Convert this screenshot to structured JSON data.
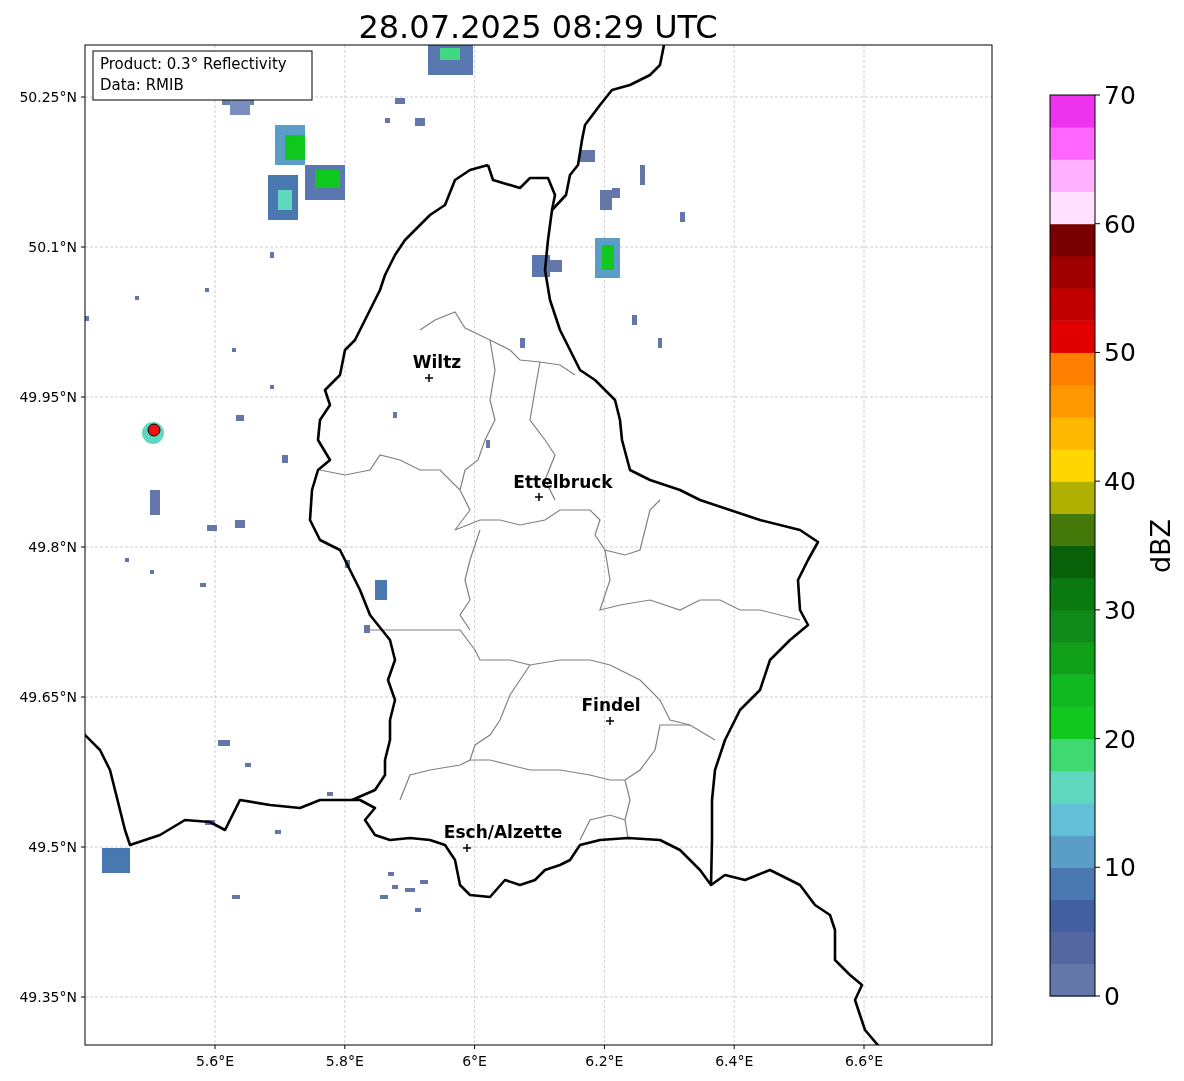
{
  "title": "28.07.2025 08:29 UTC",
  "info_box": {
    "lines": [
      "Product: 0.3° Reflectivity",
      "Data: RMIB"
    ]
  },
  "map": {
    "lat_ticks": [
      "50.25°N",
      "50.1°N",
      "49.95°N",
      "49.8°N",
      "49.65°N",
      "49.5°N",
      "49.35°N"
    ],
    "lon_ticks": [
      "5.6°E",
      "5.8°E",
      "6°E",
      "6.2°E",
      "6.4°E",
      "6.6°E"
    ],
    "places": [
      {
        "name": "Wiltz"
      },
      {
        "name": "Ettelbruck"
      },
      {
        "name": "Findel"
      },
      {
        "name": "Esch/Alzette"
      }
    ]
  },
  "colorbar": {
    "label": "dBZ",
    "ticks": [
      "70",
      "60",
      "50",
      "40",
      "30",
      "20",
      "10",
      "0"
    ],
    "bins": [
      {
        "color": "#6577a8"
      },
      {
        "color": "#5566a0"
      },
      {
        "color": "#4260a0"
      },
      {
        "color": "#4a78b0"
      },
      {
        "color": "#5a9ec8"
      },
      {
        "color": "#63c0d8"
      },
      {
        "color": "#60d8c0"
      },
      {
        "color": "#40d870"
      },
      {
        "color": "#10c820"
      },
      {
        "color": "#10b820"
      },
      {
        "color": "#10a018"
      },
      {
        "color": "#108a18"
      },
      {
        "color": "#0a7a10"
      },
      {
        "color": "#086008"
      },
      {
        "color": "#457a0a"
      },
      {
        "color": "#b0b000"
      },
      {
        "color": "#ffd700"
      },
      {
        "color": "#ffb800"
      },
      {
        "color": "#ff9800"
      },
      {
        "color": "#ff7f00"
      },
      {
        "color": "#e00000"
      },
      {
        "color": "#c00000"
      },
      {
        "color": "#a00000"
      },
      {
        "color": "#780000"
      },
      {
        "color": "#ffe0ff"
      },
      {
        "color": "#ffb0ff"
      },
      {
        "color": "#ff66ff"
      },
      {
        "color": "#ee33ee"
      }
    ]
  }
}
